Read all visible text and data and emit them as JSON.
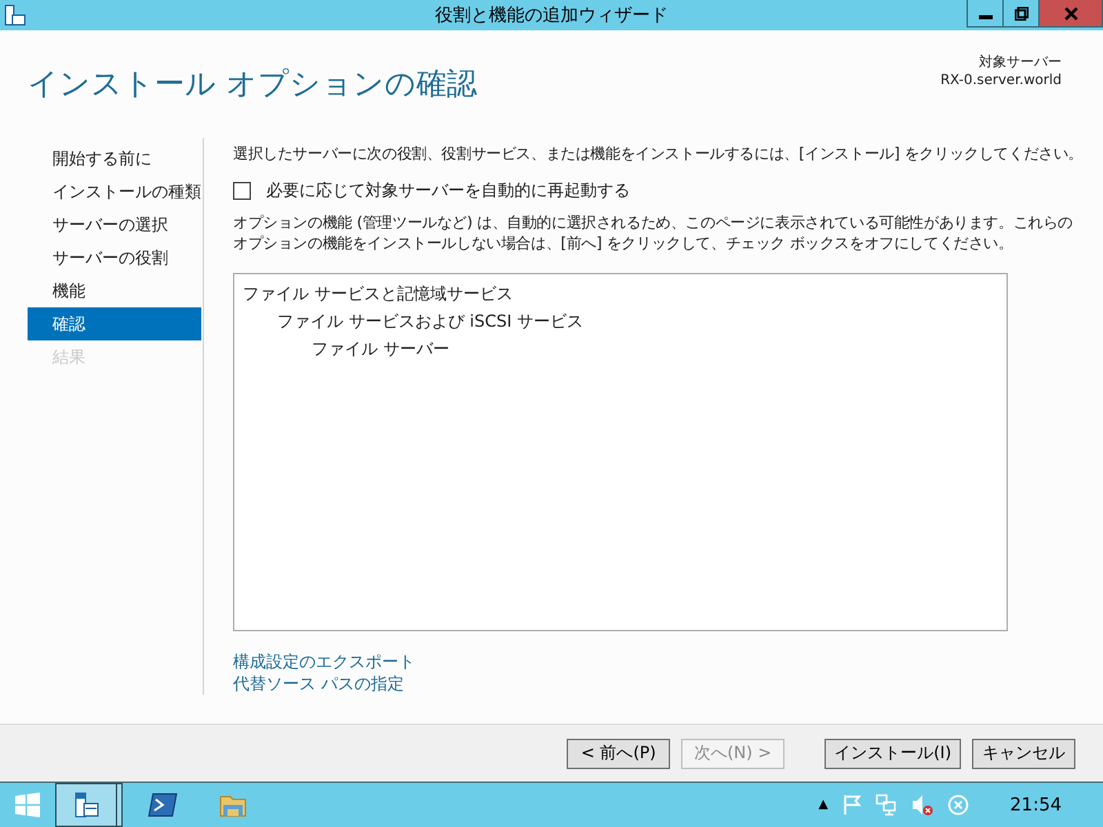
{
  "window": {
    "title": "役割と機能の追加ウィザード"
  },
  "header": {
    "title": "インストール オプションの確認",
    "target_label": "対象サーバー",
    "target_server": "RX-0.server.world"
  },
  "steps": [
    {
      "label": "開始する前に",
      "selected": false,
      "disabled": false
    },
    {
      "label": "インストールの種類",
      "selected": false,
      "disabled": false
    },
    {
      "label": "サーバーの選択",
      "selected": false,
      "disabled": false
    },
    {
      "label": "サーバーの役割",
      "selected": false,
      "disabled": false
    },
    {
      "label": "機能",
      "selected": false,
      "disabled": false
    },
    {
      "label": "確認",
      "selected": true,
      "disabled": false
    },
    {
      "label": "結果",
      "selected": false,
      "disabled": true
    }
  ],
  "intro": "選択したサーバーに次の役割、役割サービス、または機能をインストールするには、[インストール] をクリックしてください。",
  "restart_option": {
    "label": "必要に応じて対象サーバーを自動的に再起動する",
    "checked": false
  },
  "note_lines": [
    "オプションの機能 (管理ツールなど) は、自動的に選択されるため、このページに表示されている可能性があります。これらの",
    "オプションの機能をインストールしない場合は、[前へ] をクリックして、チェック ボックスをオフにしてください。"
  ],
  "selection_tree": [
    {
      "label": "ファイル サービスと記憶域サービス",
      "children": [
        {
          "label": "ファイル サービスおよび iSCSI サービス",
          "children": [
            {
              "label": "ファイル サーバー"
            }
          ]
        }
      ]
    }
  ],
  "links": [
    "構成設定のエクスポート",
    "代替ソース パスの指定"
  ],
  "buttons": [
    {
      "label": "< 前へ(P)",
      "disabled": false
    },
    {
      "label": "次へ(N) >",
      "disabled": true
    },
    {
      "label": "インストール(I)",
      "disabled": false
    },
    {
      "label": "キャンセル",
      "disabled": false
    }
  ],
  "taskbar": {
    "apps": [
      {
        "kind": "server-manager",
        "selected": true
      },
      {
        "kind": "powershell",
        "selected": false
      },
      {
        "kind": "explorer",
        "selected": false
      }
    ],
    "tray_arrow": "▲",
    "clock": "21:54"
  }
}
